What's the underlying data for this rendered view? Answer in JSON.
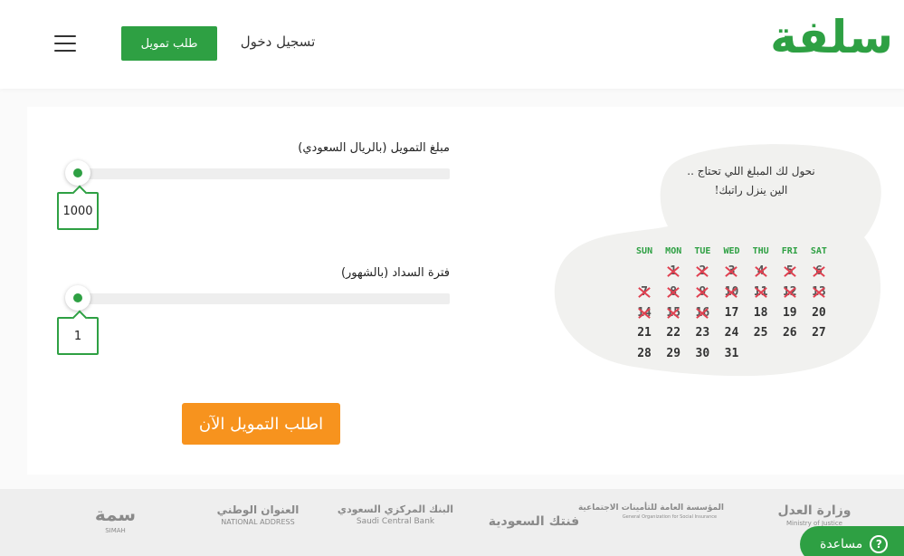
{
  "header": {
    "logo": "سلفة",
    "login_label": "تسجيل دخول",
    "request_label": "طلب تمويل",
    "menu_icon": "hamburger-icon"
  },
  "form": {
    "amount": {
      "label": "مبلغ التمويل (بالريال السعودي)",
      "value": "1000",
      "slider_fraction": 0
    },
    "period": {
      "label": "فترة السداد (بالشهور)",
      "value": "1",
      "slider_fraction": 0
    },
    "submit_label": "اطلب التمويل الآن"
  },
  "promo": {
    "line1": "نحول لك المبلغ اللي تحتاج ..",
    "line2": "الين ينزل راتبك!"
  },
  "calendar": {
    "days": [
      "SUN",
      "MON",
      "TUE",
      "WED",
      "THU",
      "FRI",
      "SAT"
    ],
    "weeks": [
      [
        "",
        "1",
        "2",
        "3",
        "4",
        "5",
        "6"
      ],
      [
        "7",
        "8",
        "9",
        "10",
        "11",
        "12",
        "13"
      ],
      [
        "14",
        "15",
        "16",
        "17",
        "18",
        "19",
        "20"
      ],
      [
        "21",
        "22",
        "23",
        "24",
        "25",
        "26",
        "27"
      ],
      [
        "28",
        "29",
        "30",
        "31",
        "",
        "",
        ""
      ]
    ],
    "crossed_through": 16
  },
  "footer": {
    "partners": [
      {
        "name": "وزارة العدل",
        "sub": "Ministry of Justice"
      },
      {
        "name": "المؤسسة العامة للتأمينات الاجتماعية",
        "sub": "General Organization for Social Insurance"
      },
      {
        "name": "فنتك السعودية",
        "sub": ""
      },
      {
        "name": "البنك المركزي السعودي",
        "sub": "Saudi Central Bank"
      },
      {
        "name": "العنوان الوطني",
        "sub": "NATIONAL ADDRESS"
      },
      {
        "name": "سمة",
        "sub": "SIMAH"
      }
    ]
  },
  "help": {
    "label": "مساعدة",
    "icon": "question-icon"
  },
  "colors": {
    "brand_green": "#2ea043",
    "cta_orange": "#f7931e",
    "cross_red": "#e04050"
  }
}
